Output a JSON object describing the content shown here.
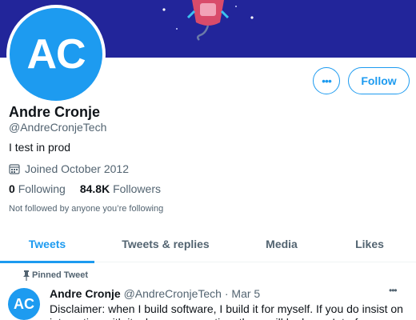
{
  "profile": {
    "avatar_initials": "AC",
    "display_name": "Andre Cronje",
    "handle": "@AndreCronjeTech",
    "bio": "I test in prod",
    "joined": "Joined October 2012",
    "following_count": "0",
    "following_label": "Following",
    "followers_count": "84.8K",
    "followers_label": "Followers",
    "follow_note": "Not followed by anyone you’re following"
  },
  "actions": {
    "more_label": "•••",
    "follow_label": "Follow"
  },
  "tabs": [
    {
      "label": "Tweets",
      "active": true
    },
    {
      "label": "Tweets & replies",
      "active": false
    },
    {
      "label": "Media",
      "active": false
    },
    {
      "label": "Likes",
      "active": false
    }
  ],
  "pinned_tweet": {
    "pinned_label": "Pinned Tweet",
    "avatar_initials": "AC",
    "author_name": "Andre Cronje",
    "author_meta": "@AndreCronjeTech · Mar 5",
    "more_label": "•••",
    "text": "Disclaimer: when I build software, I build it for myself. If you do insist on interacting with it, please use caution, there will be bugs. Interfaces are"
  },
  "colors": {
    "accent": "#1d9bf0",
    "banner": "#22259a",
    "text_primary": "#0f1419",
    "text_secondary": "#536471"
  }
}
